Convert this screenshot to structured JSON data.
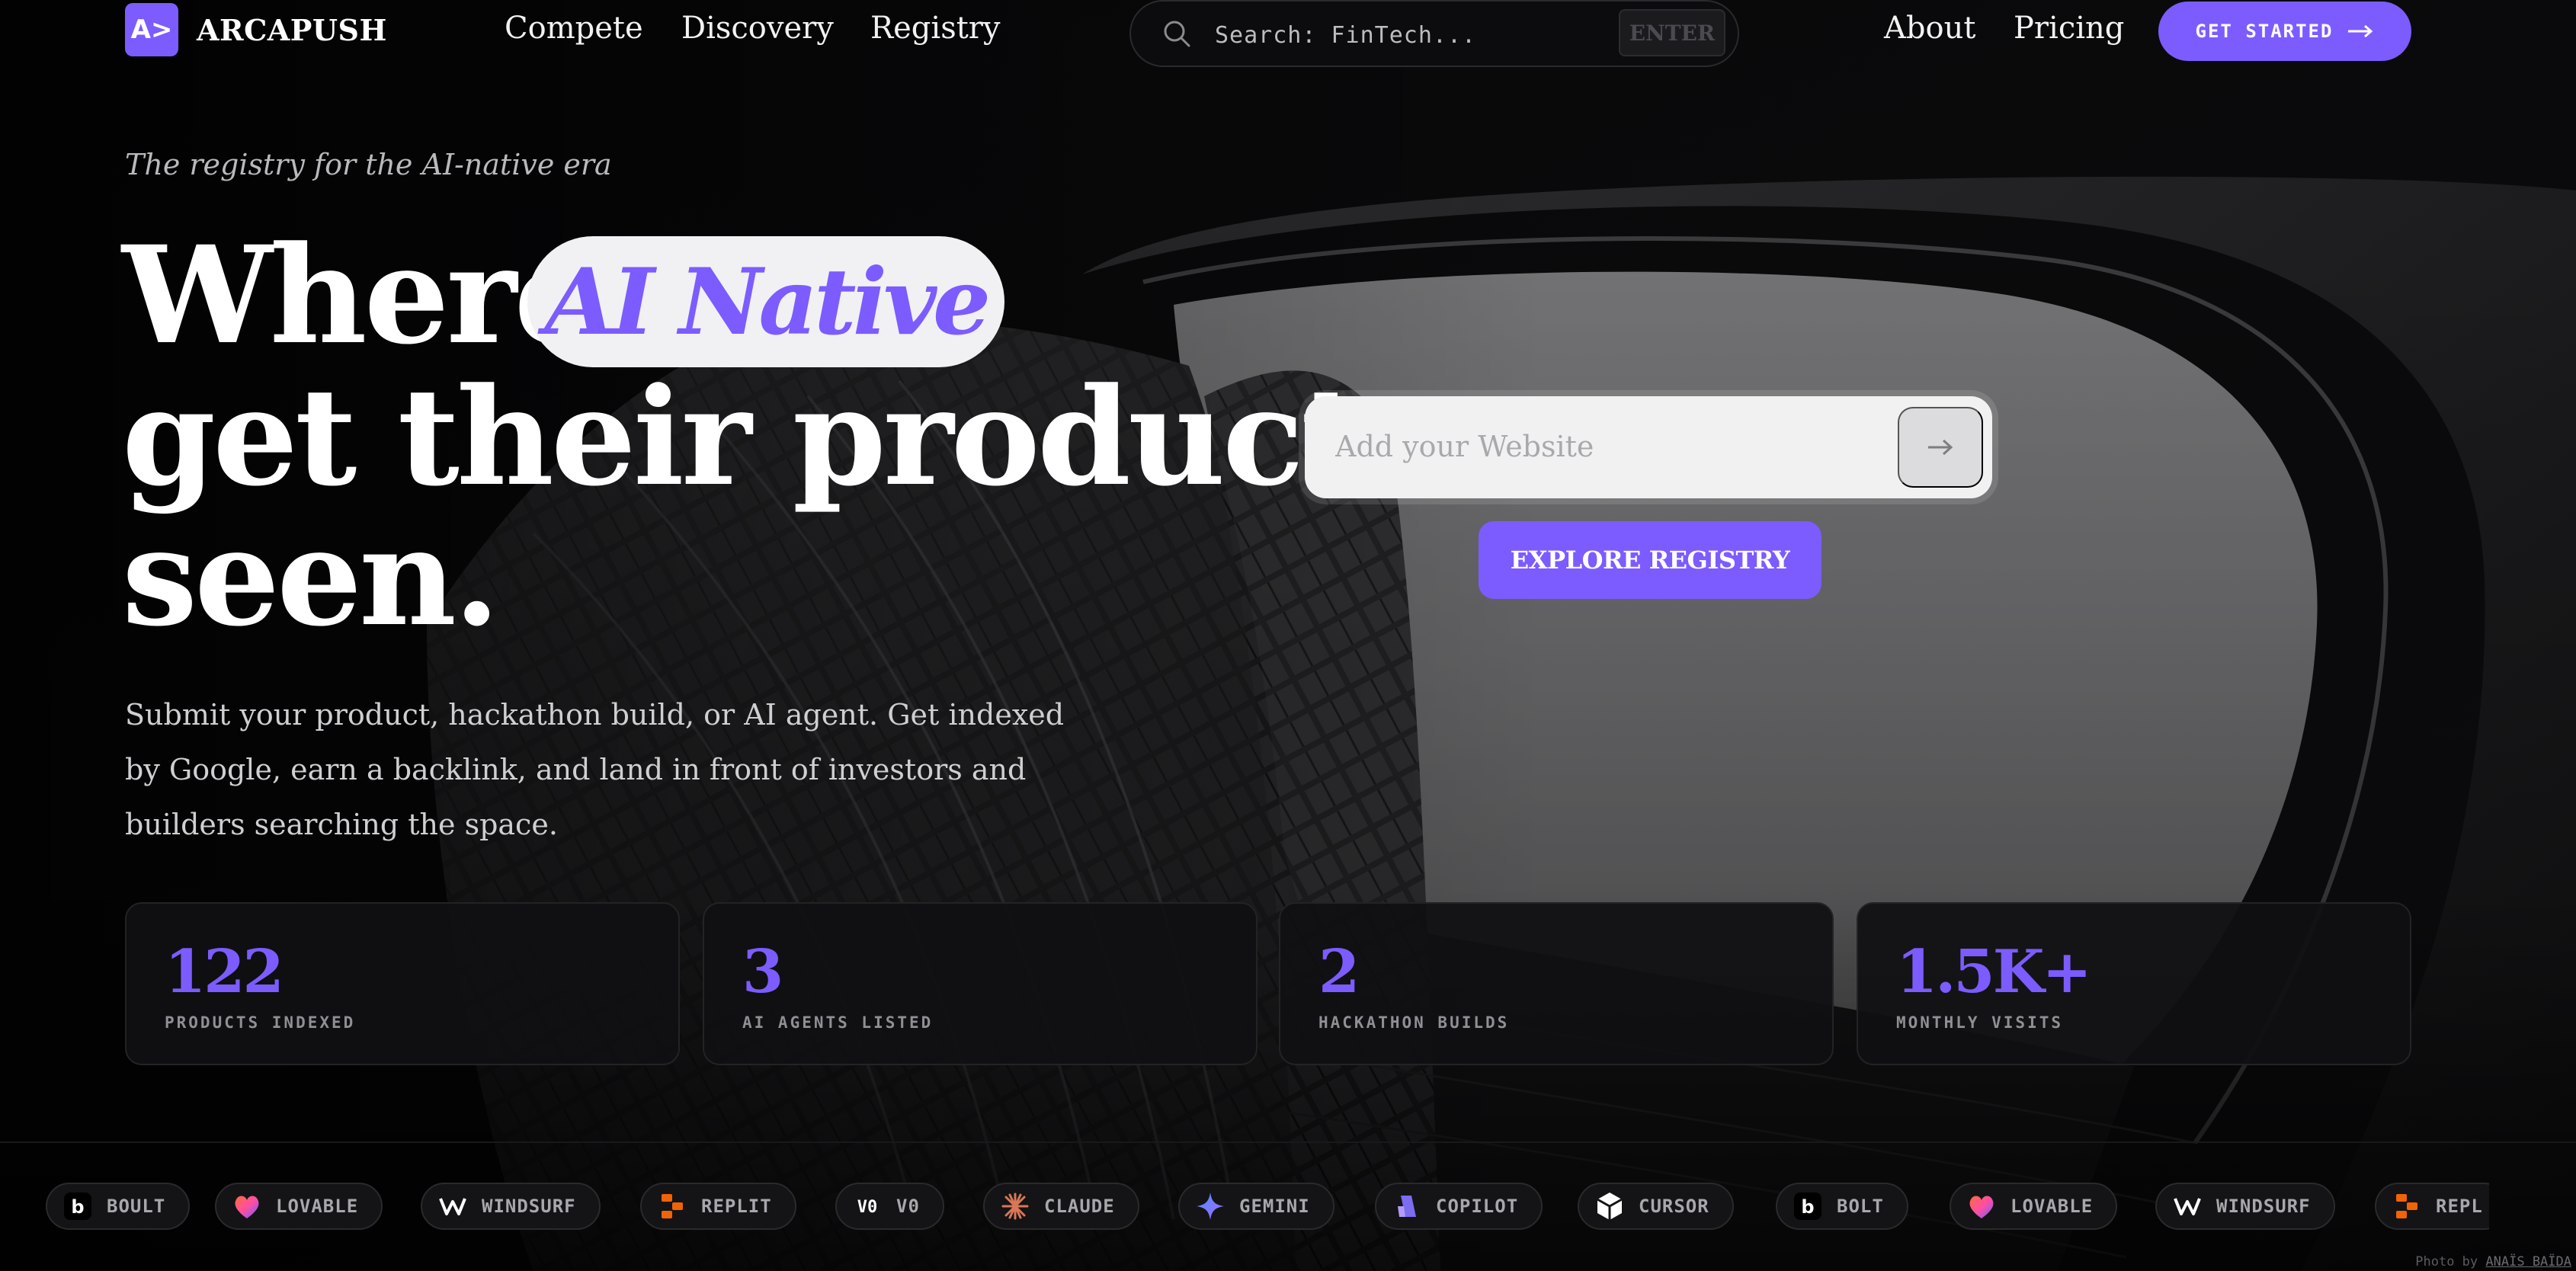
{
  "brand": {
    "logo_glyph": "A>",
    "name": "ARCAPUSH",
    "accent": "#7c5cff"
  },
  "nav": {
    "links": [
      "Compete",
      "Discovery",
      "Registry",
      "About",
      "Pricing"
    ],
    "search_placeholder": "Search: FinTech...",
    "search_key": "ENTER",
    "cta_label": "GET STARTED"
  },
  "hero": {
    "tagline": "The registry for the AI-native era",
    "headline_1": "Where",
    "highlight": "AI Native",
    "headline_2": "get their products",
    "headline_3": "seen.",
    "description": "Submit your product, hackathon build, or AI agent. Get indexed by Google, earn a backlink, and land in front of investors and builders searching the space.",
    "website_placeholder": "Add your Website",
    "explore_label": "EXPLORE REGISTRY"
  },
  "stats": [
    {
      "value": "122",
      "label": "PRODUCTS INDEXED"
    },
    {
      "value": "3",
      "label": "AI AGENTS LISTED"
    },
    {
      "value": "2",
      "label": "HACKATHON BUILDS"
    },
    {
      "value": "1.5K+",
      "label": "MONTHLY VISITS"
    }
  ],
  "builders": [
    {
      "name": "BOULT",
      "icon": "bolt-icon"
    },
    {
      "name": "LOVABLE",
      "icon": "lovable-heart-icon"
    },
    {
      "name": "WINDSURF",
      "icon": "windsurf-icon"
    },
    {
      "name": "REPLIT",
      "icon": "replit-icon"
    },
    {
      "name": "V0",
      "icon": "v0-icon"
    },
    {
      "name": "CLAUDE",
      "icon": "claude-icon"
    },
    {
      "name": "GEMINI",
      "icon": "gemini-icon"
    },
    {
      "name": "COPILOT",
      "icon": "copilot-icon"
    },
    {
      "name": "CURSOR",
      "icon": "cursor-icon"
    },
    {
      "name": "BOLT",
      "icon": "bolt-icon"
    },
    {
      "name": "LOVABLE",
      "icon": "lovable-heart-icon"
    },
    {
      "name": "WINDSURF",
      "icon": "windsurf-icon"
    },
    {
      "name": "REPL",
      "icon": "replit-icon"
    }
  ],
  "photo_credit": {
    "prefix": "Photo by",
    "author": "ANAÏS BAÏDA"
  }
}
